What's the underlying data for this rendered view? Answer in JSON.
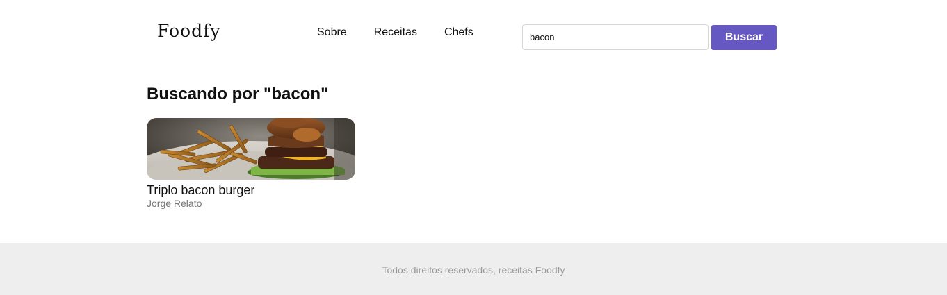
{
  "header": {
    "logo": "Foodfy",
    "nav": [
      "Sobre",
      "Receitas",
      "Chefs"
    ]
  },
  "search": {
    "value": "bacon",
    "button_label": "Buscar"
  },
  "main": {
    "title": "Buscando por \"bacon\"",
    "recipes": [
      {
        "title": "Triplo bacon burger",
        "author": "Jorge Relato",
        "image": "burger-with-fries-photo"
      }
    ]
  },
  "footer": {
    "text": "Todos direitos reservados, receitas Foodfy"
  },
  "colors": {
    "accent": "#6558c3",
    "footer_bg": "#eeeeee",
    "muted_text": "#777777"
  }
}
